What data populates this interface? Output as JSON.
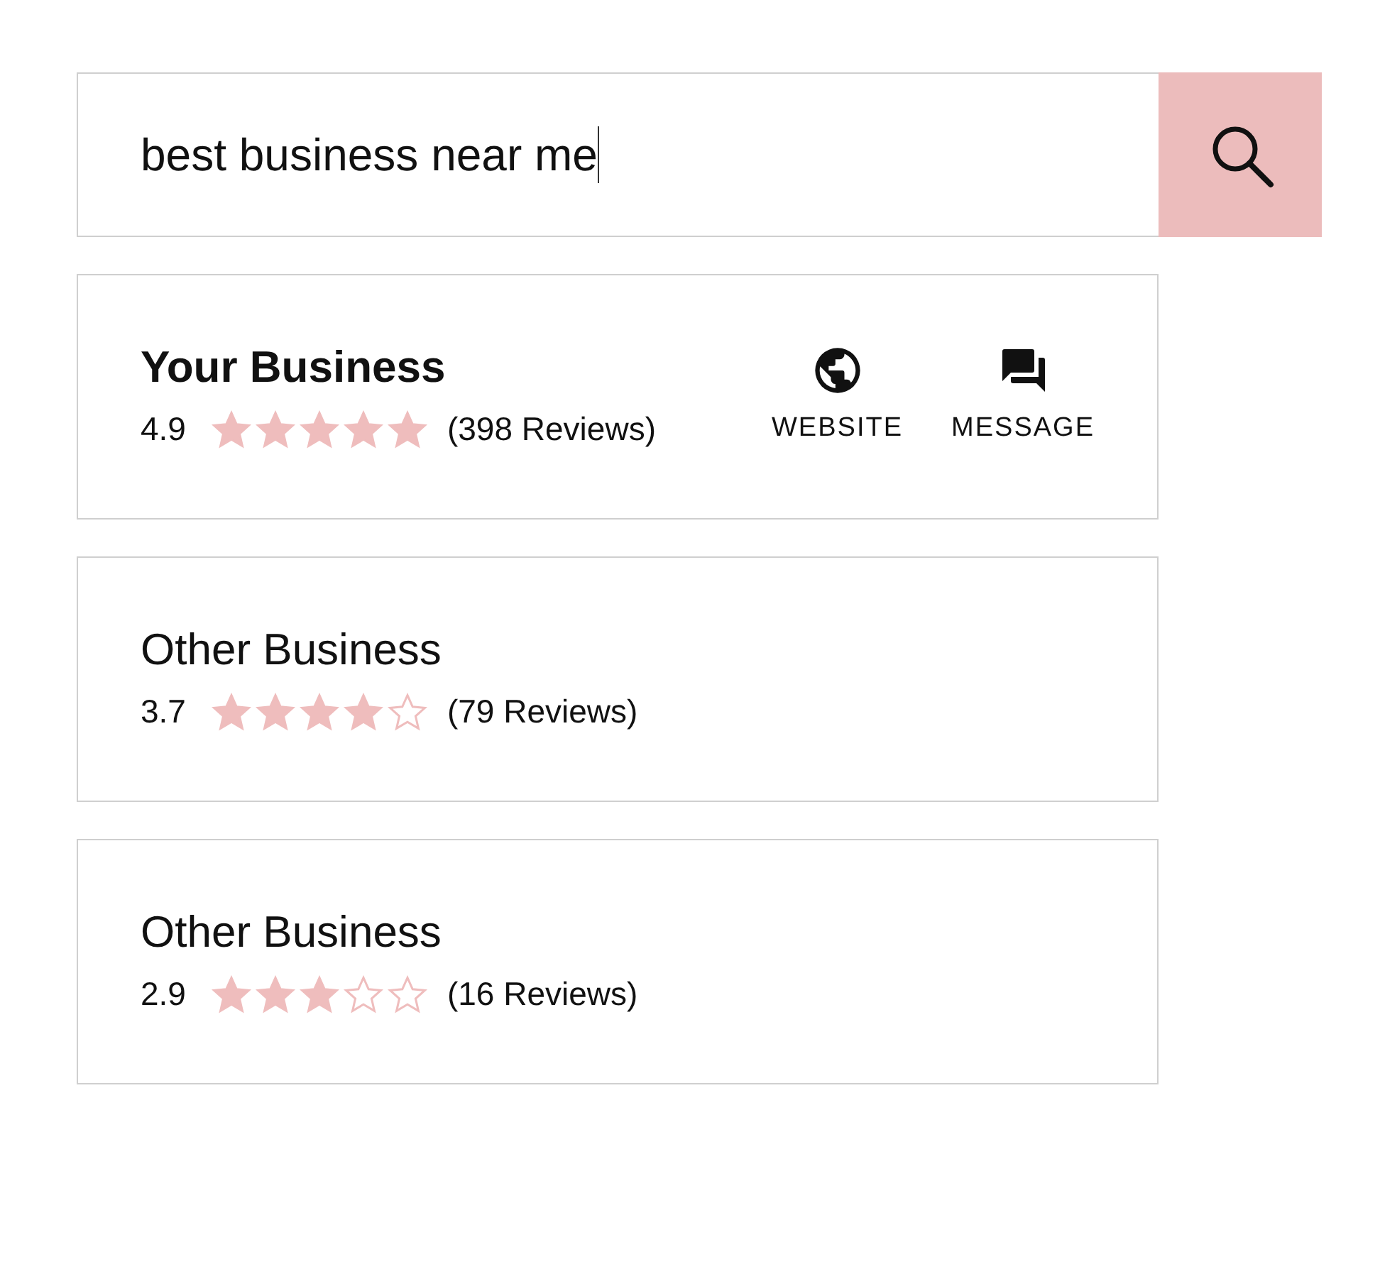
{
  "search": {
    "value": "best business near me",
    "focused": true
  },
  "results": [
    {
      "kind": "featured",
      "name": "Your Business",
      "rating": "4.9",
      "stars": 5,
      "reviews": "(398 Reviews)",
      "actions": [
        {
          "kind": "globe",
          "label": "WEBSITE"
        },
        {
          "kind": "chat",
          "label": "MESSAGE"
        }
      ]
    },
    {
      "kind": "plain",
      "name": "Other Business",
      "rating": "3.7",
      "stars": 4,
      "reviews": "(79 Reviews)"
    },
    {
      "kind": "plain",
      "name": "Other Business",
      "rating": "2.9",
      "stars": 3,
      "reviews": "(16 Reviews)"
    }
  ]
}
